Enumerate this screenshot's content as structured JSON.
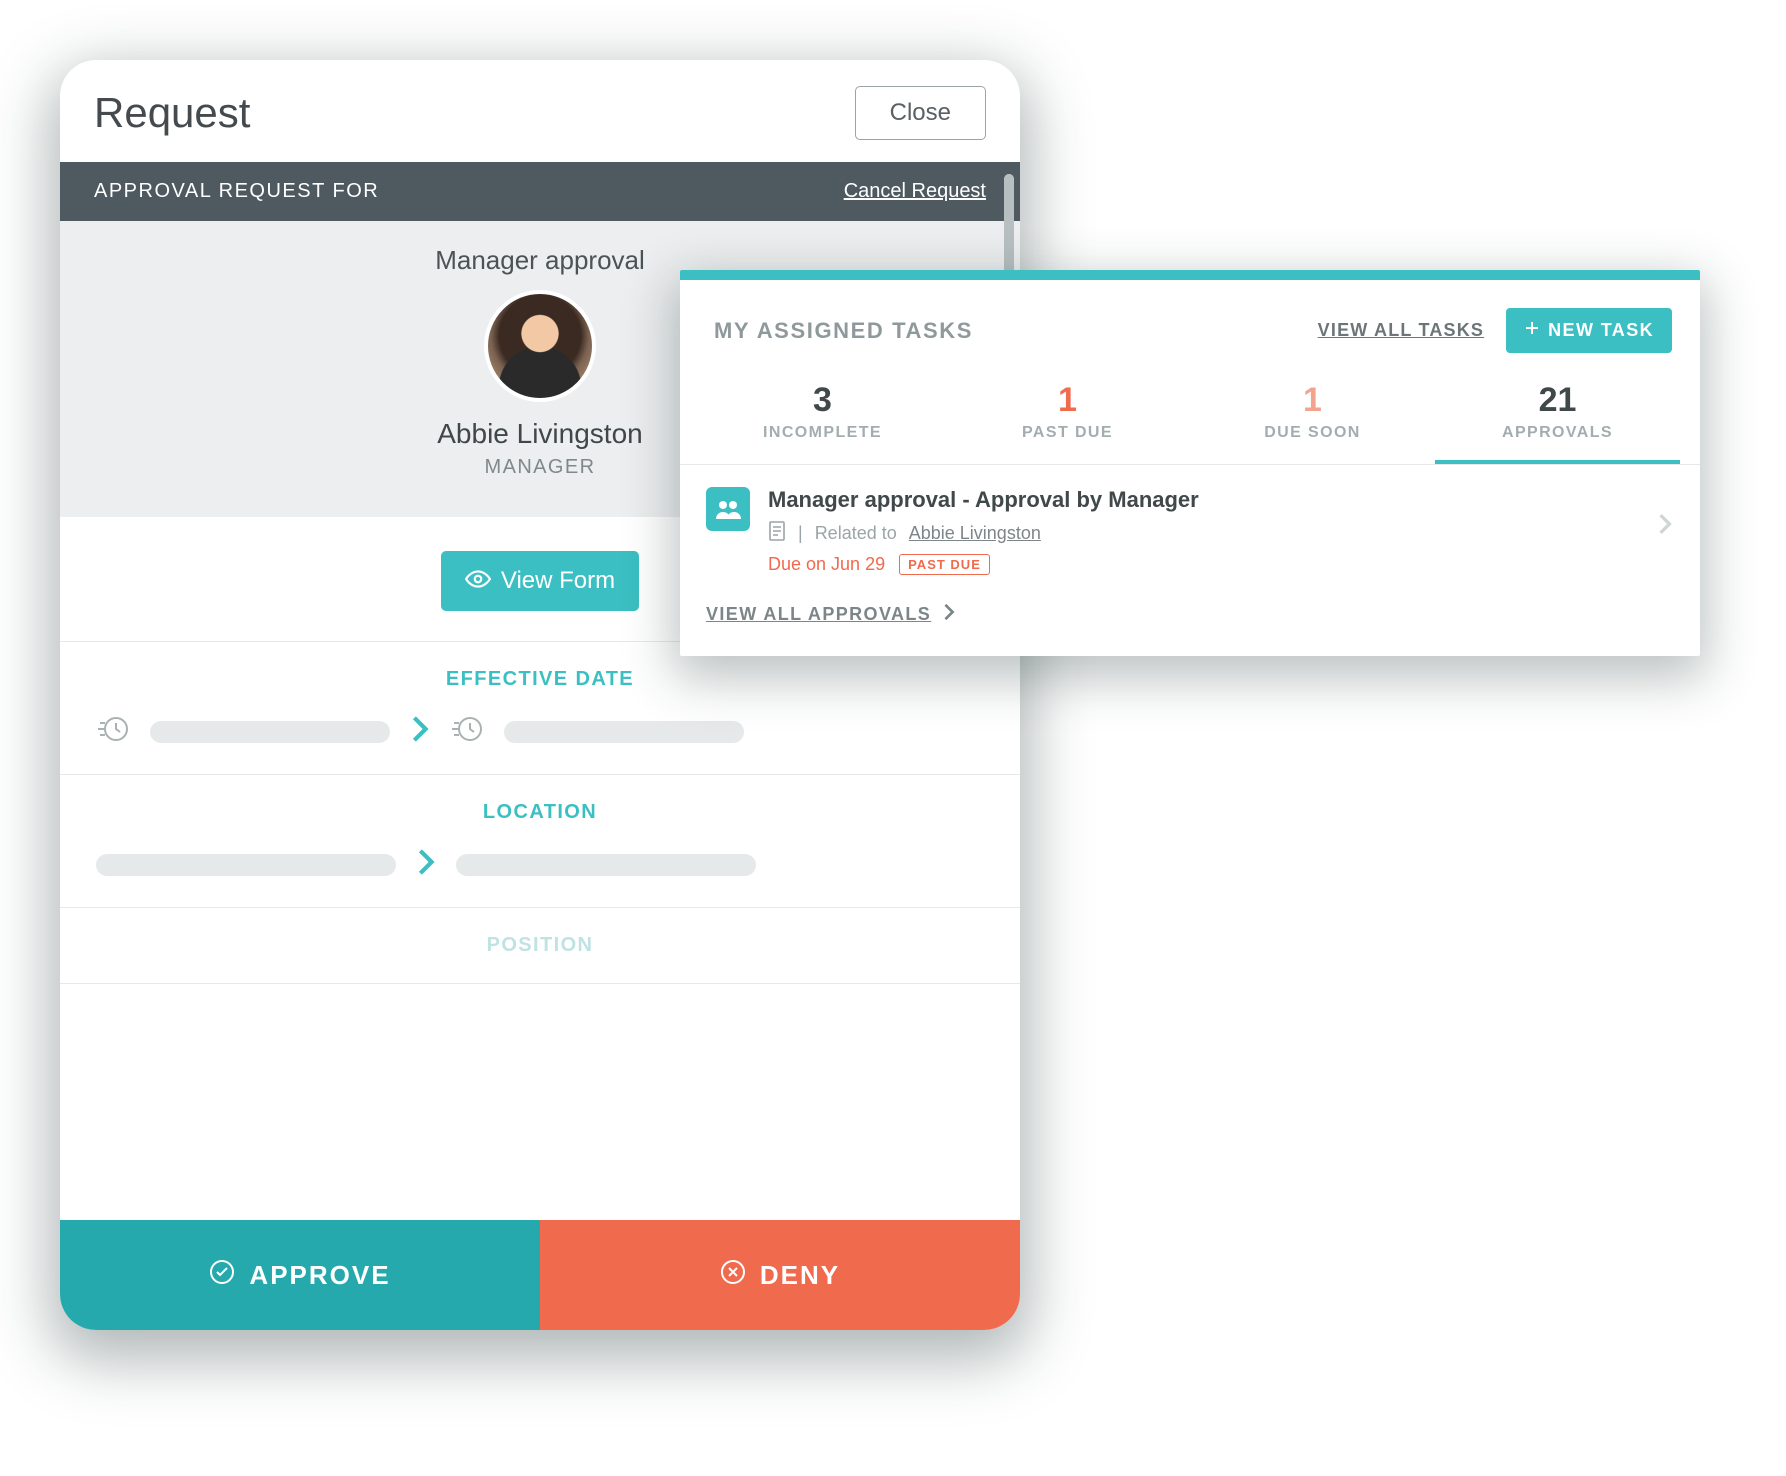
{
  "modal": {
    "title": "Request",
    "close_label": "Close",
    "subheader_label": "APPROVAL REQUEST FOR",
    "cancel_label": "Cancel Request",
    "approval_title": "Manager approval",
    "person_name": "Abbie Livingston",
    "person_role": "MANAGER",
    "view_form_label": "View Form",
    "sections": {
      "effective_date": "EFFECTIVE DATE",
      "location": "LOCATION",
      "position": "POSITION"
    },
    "approve_label": "APPROVE",
    "deny_label": "DENY"
  },
  "tasks": {
    "title": "MY ASSIGNED TASKS",
    "view_all_label": "VIEW ALL TASKS",
    "new_task_label": "NEW TASK",
    "stats": [
      {
        "count": "3",
        "label": "INCOMPLETE",
        "tone": "",
        "active": false
      },
      {
        "count": "1",
        "label": "PAST DUE",
        "tone": "orange",
        "active": false
      },
      {
        "count": "1",
        "label": "DUE SOON",
        "tone": "lorange",
        "active": false
      },
      {
        "count": "21",
        "label": "APPROVALS",
        "tone": "",
        "active": true
      }
    ],
    "item": {
      "title": "Manager approval - Approval by Manager",
      "related_label": "Related to",
      "related_name": "Abbie Livingston",
      "due_text": "Due on Jun 29",
      "badge": "PAST DUE"
    },
    "view_all_approvals": "VIEW ALL APPROVALS"
  }
}
